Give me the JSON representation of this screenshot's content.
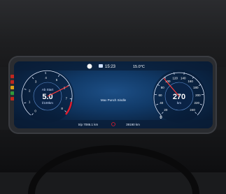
{
  "status_bar": {
    "time": "15:23",
    "outside_temp": "15.0°C"
  },
  "left_gauge": {
    "label": "Ab Start",
    "value": "5.0",
    "unit": "l/100km",
    "ticks": [
      "0",
      "1",
      "2",
      "3",
      "4",
      "5",
      "6",
      "7",
      "8"
    ]
  },
  "right_gauge": {
    "speed": "270",
    "unit": "km",
    "fuel_label": "0",
    "ticks": [
      "20",
      "40",
      "60",
      "80",
      "100",
      "120",
      "140",
      "160",
      "180",
      "200",
      "220",
      "240"
    ]
  },
  "center_message": "Max Punch Sindle",
  "footer": {
    "trip": "trip 7086.1 km",
    "odometer": "39190 km"
  },
  "colors": {
    "needle": "#ff3b3b",
    "accent_red": "#e11d2e",
    "tick": "#dfeaff",
    "screen_glow": "#1d4f86"
  }
}
